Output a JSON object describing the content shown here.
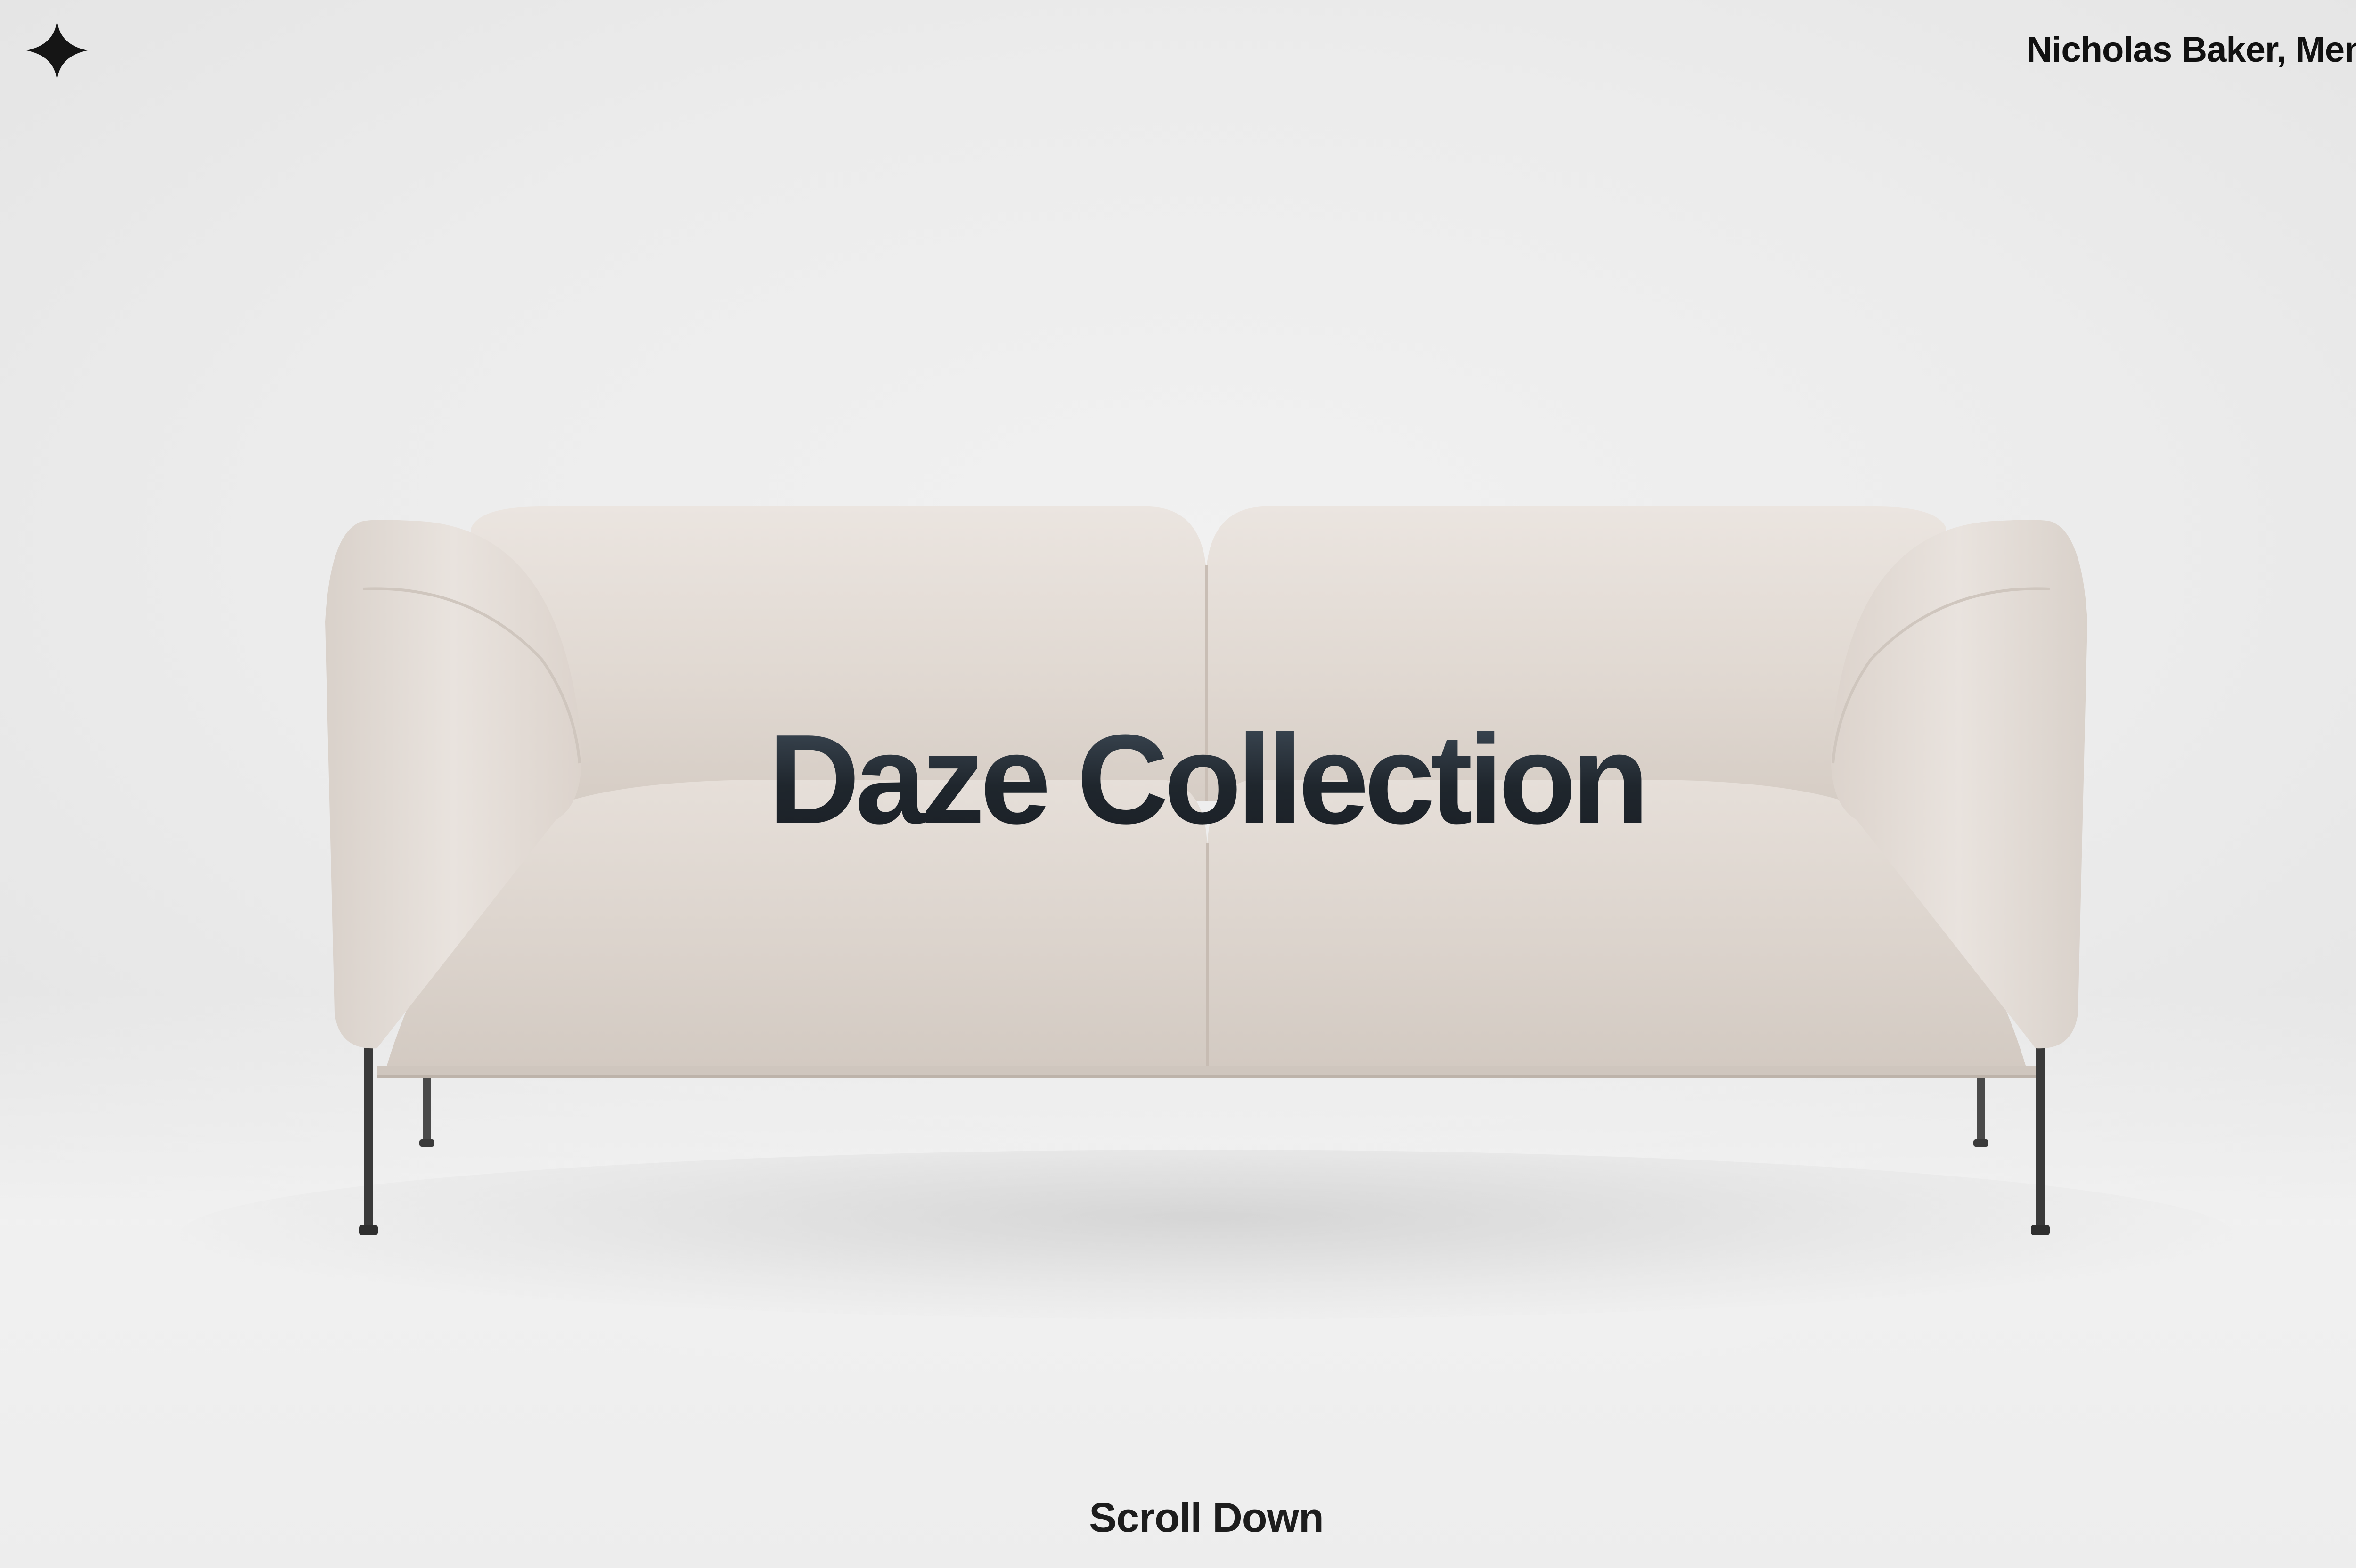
{
  "header": {
    "logo_icon": "four-point-star-icon",
    "owner_name": "Nicholas Baker,",
    "menu_label": "Menu"
  },
  "hero": {
    "title": "Daze Collection",
    "image": "sofa-image"
  },
  "footer": {
    "scroll_label": "Scroll Down"
  },
  "colors": {
    "background": "#ececec",
    "sofa_fabric": "#e3dcd6",
    "sofa_legs": "#3a3a3a",
    "title_text": "#22272d",
    "nav_text": "#111111"
  }
}
